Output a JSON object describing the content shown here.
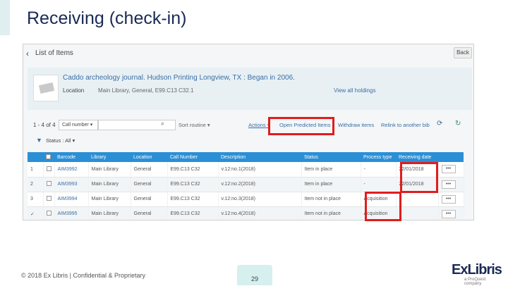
{
  "slide": {
    "title": "Receiving (check-in)",
    "footer": "© 2018 Ex Libris | Confidential & Proprietary",
    "page_number": "29",
    "logo_text": "ExLibris",
    "logo_sub": "a ProQuest company"
  },
  "screen": {
    "header": {
      "title": "List of Items",
      "back_label": "Back"
    },
    "record": {
      "title": "Caddo archeology journal. Hudson Printing Longview, TX : Began in 2006.",
      "location_label": "Location",
      "location_value": "Main Library, General, E99.C13 C32.1",
      "view_holdings": "View all holdings"
    },
    "toolbar": {
      "pager": "1 - 4 of 4",
      "sort_field": "Call number",
      "sort_routine": "Sort routine",
      "actions": "Actions",
      "open_predicted": "Open Predicted Items",
      "withdraw": "Withdraw items",
      "relink": "Relink to another bib"
    },
    "filter": {
      "label": "Status : All"
    },
    "table": {
      "headers": [
        "",
        "",
        "Barcode",
        "Library",
        "Location",
        "Call Number",
        "Description",
        "Status",
        "Process type",
        "Receiving date",
        ""
      ],
      "rows": [
        {
          "num": "1",
          "barcode": "AIM3992",
          "library": "Main Library",
          "location": "General",
          "call": "E99.C13 C32",
          "desc": "v.12:no.1(2018)",
          "status": "Item in place",
          "process": "-",
          "date": "22/01/2018",
          "action": "•••"
        },
        {
          "num": "2",
          "barcode": "AIM3993",
          "library": "Main Library",
          "location": "General",
          "call": "E99.C13 C32",
          "desc": "v.12:no.2(2018)",
          "status": "Item in place",
          "process": "-",
          "date": "22/01/2018",
          "action": "•••"
        },
        {
          "num": "3",
          "barcode": "AIM3994",
          "library": "Main Library",
          "location": "General",
          "call": "E99.C13 C32",
          "desc": "v.12:no.3(2018)",
          "status": "Item not in place",
          "process": "Acquisition",
          "date": "-",
          "action": "•••"
        },
        {
          "num": "4",
          "barcode": "AIM3995",
          "library": "Main Library",
          "location": "General",
          "call": "E99.C13 C32",
          "desc": "v.12:no.4(2018)",
          "status": "Item not in place",
          "process": "Acquisition",
          "date": "-",
          "action": "•••"
        }
      ]
    }
  },
  "colors": {
    "accent": "#2b8fd6",
    "highlight": "#e11d1d",
    "title": "#1a2a55"
  }
}
